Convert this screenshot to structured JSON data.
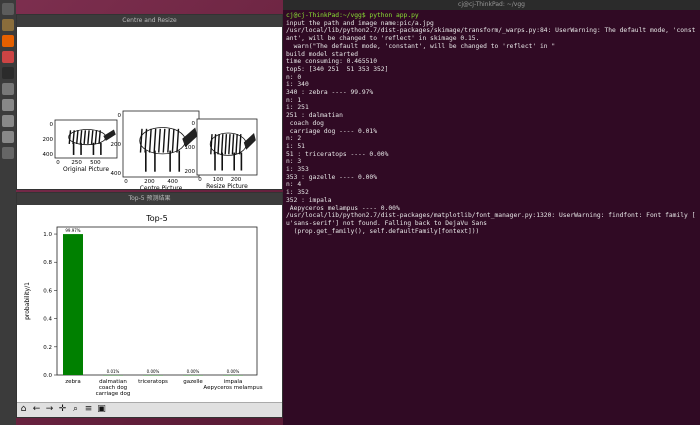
{
  "launcher_icons": [
    "dash-icon",
    "files-icon",
    "firefox-icon",
    "software-icon",
    "terminal-icon",
    "settings-icon",
    "app-icon",
    "app-icon",
    "app-icon",
    "trash-icon"
  ],
  "centre_window": {
    "title": "Centre and Resize",
    "subplots": [
      {
        "caption": "Original Picture",
        "yticks": [
          "0",
          "200",
          "400"
        ],
        "xticks": [
          "0",
          "250",
          "500"
        ]
      },
      {
        "caption": "Centre Picture",
        "yticks": [
          "0",
          "200",
          "400"
        ],
        "xticks": [
          "0",
          "200",
          "400"
        ]
      },
      {
        "caption": "Resize Picture",
        "yticks": [
          "0",
          "100",
          "200"
        ],
        "xticks": [
          "0",
          "100",
          "200"
        ]
      }
    ]
  },
  "top5_window": {
    "title": "Top-5 预测结果",
    "chart_data": {
      "type": "bar",
      "title": "Top-5",
      "ylabel": "probability/1",
      "categories": [
        "zebra",
        "dalmatian\ncoach dog\ncarriage dog",
        "triceratops",
        "gazelle",
        "impala\nAepyceros melampus"
      ],
      "values": [
        0.9997,
        0.0001,
        0.0,
        0.0,
        0.0
      ],
      "data_labels": [
        "99.97%",
        "0.01%",
        "0.00%",
        "0.00%",
        "0.00%"
      ],
      "ylim": [
        0,
        1.05
      ],
      "yticks": [
        "0.0",
        "0.2",
        "0.4",
        "0.6",
        "0.8",
        "1.0"
      ],
      "bar_color": "#008000"
    },
    "toolbar": [
      "home-icon",
      "back-icon",
      "forward-icon",
      "pan-icon",
      "zoom-icon",
      "configure-icon",
      "save-icon"
    ]
  },
  "terminal": {
    "title": "cj@cj-ThinkPad: ~/vgg",
    "lines": [
      "cj@cj-ThinkPad:~/vgg$ python app.py",
      "input the path and image name:pic/a.jpg",
      "/usr/local/lib/python2.7/dist-packages/skimage/transform/_warps.py:84: UserWarning: The default mode, 'const",
      "ant', will be changed to 'reflect' in skimage 0.15.",
      "  warn(\"The default mode, 'constant', will be changed to 'reflect' in \"",
      "build model started",
      "time consuming: 0.465510",
      "top5: [340 251  51 353 352]",
      "n: 0",
      "i: 340",
      "340 : zebra ---- 99.97%",
      "n: 1",
      "i: 251",
      "251 : dalmatian",
      " coach dog",
      " carriage dog ---- 0.01%",
      "n: 2",
      "i: 51",
      "51 : triceratops ---- 0.00%",
      "n: 3",
      "i: 353",
      "353 : gazelle ---- 0.00%",
      "n: 4",
      "i: 352",
      "352 : impala",
      " Aepyceros melampus ---- 0.00%",
      "/usr/local/lib/python2.7/dist-packages/matplotlib/font_manager.py:1320: UserWarning: findfont: Font family [",
      "u'sans-serif'] not found. Falling back to DejaVu Sans",
      "  (prop.get_family(), self.defaultFamily[fontext]))"
    ]
  }
}
